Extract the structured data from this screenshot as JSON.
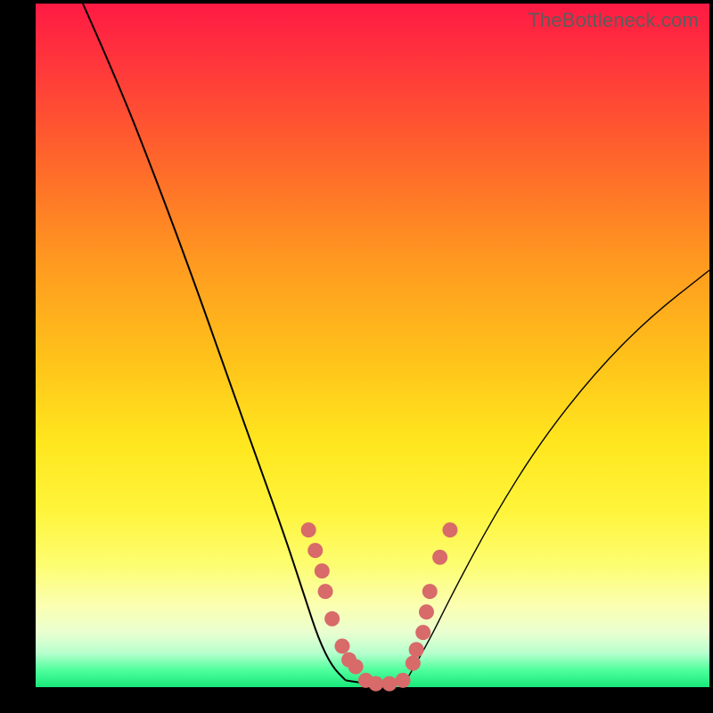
{
  "watermark": "TheBottleneck.com",
  "colors": {
    "background_frame": "#000000",
    "marker": "#d86a6a",
    "curve": "#000000",
    "gradient_top": "#ff1a44",
    "gradient_bottom": "#18e87a"
  },
  "chart_data": {
    "type": "line",
    "title": "",
    "xlabel": "",
    "ylabel": "",
    "xlim": [
      0,
      1
    ],
    "ylim": [
      0,
      1
    ],
    "note": "Axes are normalized 0–1 (no numeric ticks or axis labels visible in the image). y measured from bottom (0) to top (1).",
    "series": [
      {
        "name": "curve-left-descending",
        "x": [
          0.07,
          0.12,
          0.18,
          0.24,
          0.29,
          0.33,
          0.37,
          0.4,
          0.42,
          0.44,
          0.46
        ],
        "y": [
          1.0,
          0.89,
          0.74,
          0.58,
          0.44,
          0.33,
          0.22,
          0.13,
          0.07,
          0.03,
          0.01
        ]
      },
      {
        "name": "curve-bottom-flat",
        "x": [
          0.46,
          0.49,
          0.52,
          0.55
        ],
        "y": [
          0.01,
          0.005,
          0.005,
          0.01
        ]
      },
      {
        "name": "curve-right-ascending",
        "x": [
          0.55,
          0.58,
          0.62,
          0.68,
          0.75,
          0.83,
          0.91,
          1.0
        ],
        "y": [
          0.01,
          0.06,
          0.14,
          0.25,
          0.36,
          0.46,
          0.54,
          0.61
        ]
      }
    ],
    "markers": {
      "name": "highlighted-points",
      "x": [
        0.405,
        0.415,
        0.425,
        0.43,
        0.44,
        0.455,
        0.465,
        0.475,
        0.49,
        0.505,
        0.525,
        0.545,
        0.56,
        0.565,
        0.575,
        0.58,
        0.585,
        0.6,
        0.615
      ],
      "y": [
        0.23,
        0.2,
        0.17,
        0.14,
        0.1,
        0.06,
        0.04,
        0.03,
        0.01,
        0.005,
        0.005,
        0.01,
        0.035,
        0.055,
        0.08,
        0.11,
        0.14,
        0.19,
        0.23
      ]
    }
  }
}
